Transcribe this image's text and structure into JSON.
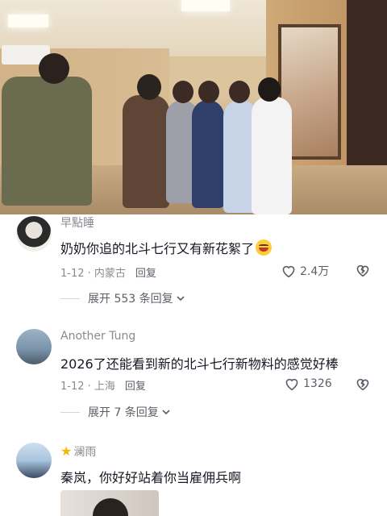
{
  "comments": [
    {
      "username": "早點睡",
      "text": "奶奶你追的北斗七行又有新花絮了",
      "emoji": "grinning-emoji",
      "date_location": "1-12 · 内蒙古",
      "reply_label": "回复",
      "likes": "2.4万",
      "expand_label": "展开 553 条回复"
    },
    {
      "username": "Another Tung",
      "text": "2026了还能看到新的北斗七行新物料的感觉好棒",
      "date_location": "1-12 · 上海",
      "reply_label": "回复",
      "likes": "1326",
      "expand_label": "展开 7 条回复"
    },
    {
      "username": "澜雨",
      "username_icon": "star-icon",
      "text": "秦岚，你好好站着你当雇佣兵啊"
    }
  ],
  "colors": {
    "secondary_text": "#8a8b91",
    "primary_text": "#161823",
    "action_text": "#5d5f68"
  }
}
